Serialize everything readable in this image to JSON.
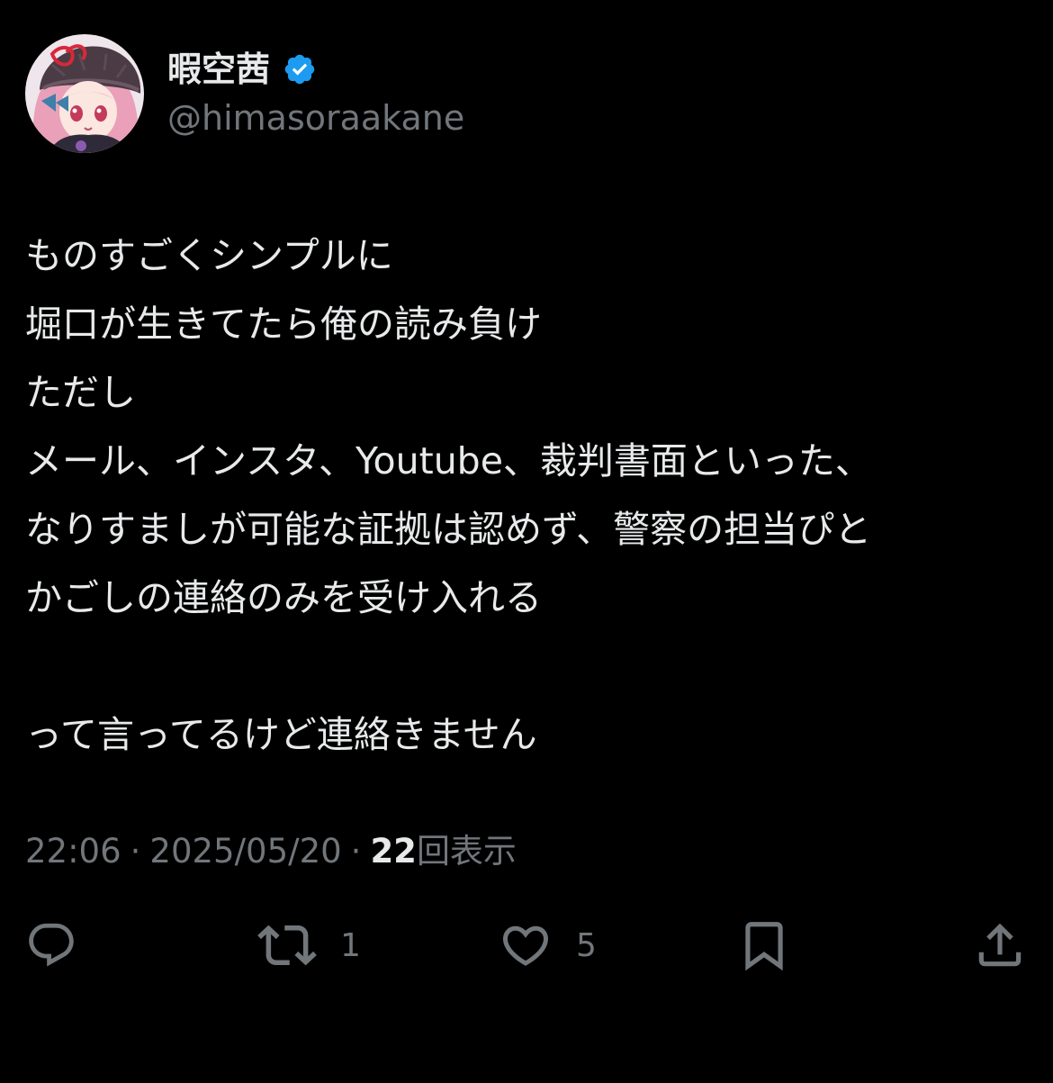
{
  "user": {
    "display_name": "暇空茜",
    "handle": "@himasoraakane",
    "verified_icon": "verified-badge-icon",
    "verified_color": "#1d9bf0"
  },
  "tweet": {
    "lines": [
      "ものすごくシンプルに",
      "堀口が生きてたら俺の読み負け",
      "ただし",
      "メール、インスタ、Youtube、裁判書面といった、",
      "なりすましが可能な証拠は認めず、警察の担当ぴと",
      "かごしの連絡のみを受け入れる",
      "",
      "って言ってるけど連絡きません"
    ]
  },
  "meta": {
    "time": "22:06",
    "separator": "·",
    "date": "2025/05/20",
    "views_count": "22",
    "views_label": "回表示"
  },
  "actions": {
    "reply": {
      "icon": "reply-icon",
      "count": ""
    },
    "retweet": {
      "icon": "retweet-icon",
      "count": "1"
    },
    "like": {
      "icon": "heart-icon",
      "count": "5"
    },
    "bookmark": {
      "icon": "bookmark-icon",
      "count": ""
    },
    "share": {
      "icon": "share-icon",
      "count": ""
    }
  },
  "colors": {
    "background": "#000000",
    "primary_text": "#e7e9ea",
    "secondary_text": "#71767b",
    "accent": "#1d9bf0"
  }
}
